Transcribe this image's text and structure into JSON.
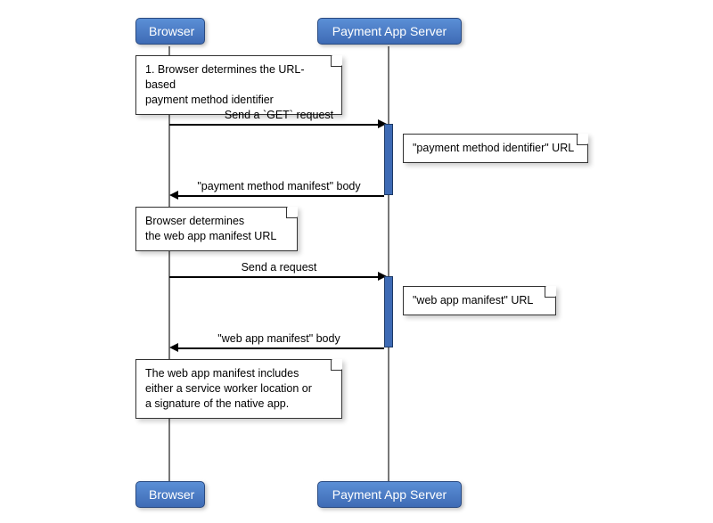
{
  "participants": {
    "left": "Browser",
    "right": "Payment App Server"
  },
  "notes": {
    "n1": "1. Browser determines the URL-based\npayment method identifier",
    "n2": "\"payment method identifier\" URL",
    "n3": "Browser determines\nthe web app manifest URL",
    "n4": "\"web app manifest\" URL",
    "n5": "The web app manifest includes\neither a service worker location or\na signature of the native app."
  },
  "messages": {
    "m1": "Send a `GET` request",
    "m2": "\"payment method manifest\" body",
    "m3": "Send a request",
    "m4": "\"web app manifest\" body"
  },
  "chart_data": {
    "type": "sequence-diagram",
    "participants": [
      "Browser",
      "Payment App Server"
    ],
    "steps": [
      {
        "kind": "note",
        "over": "Browser",
        "text": "1. Browser determines the URL-based payment method identifier"
      },
      {
        "kind": "message",
        "from": "Browser",
        "to": "Payment App Server",
        "text": "Send a `GET` request"
      },
      {
        "kind": "note",
        "over": "Payment App Server",
        "text": "\"payment method identifier\" URL"
      },
      {
        "kind": "message",
        "from": "Payment App Server",
        "to": "Browser",
        "text": "\"payment method manifest\" body"
      },
      {
        "kind": "note",
        "over": "Browser",
        "text": "Browser determines the web app manifest URL"
      },
      {
        "kind": "message",
        "from": "Browser",
        "to": "Payment App Server",
        "text": "Send a request"
      },
      {
        "kind": "note",
        "over": "Payment App Server",
        "text": "\"web app manifest\" URL"
      },
      {
        "kind": "message",
        "from": "Payment App Server",
        "to": "Browser",
        "text": "\"web app manifest\" body"
      },
      {
        "kind": "note",
        "over": "Browser",
        "text": "The web app manifest includes either a service worker location or a signature of the native app."
      }
    ]
  }
}
